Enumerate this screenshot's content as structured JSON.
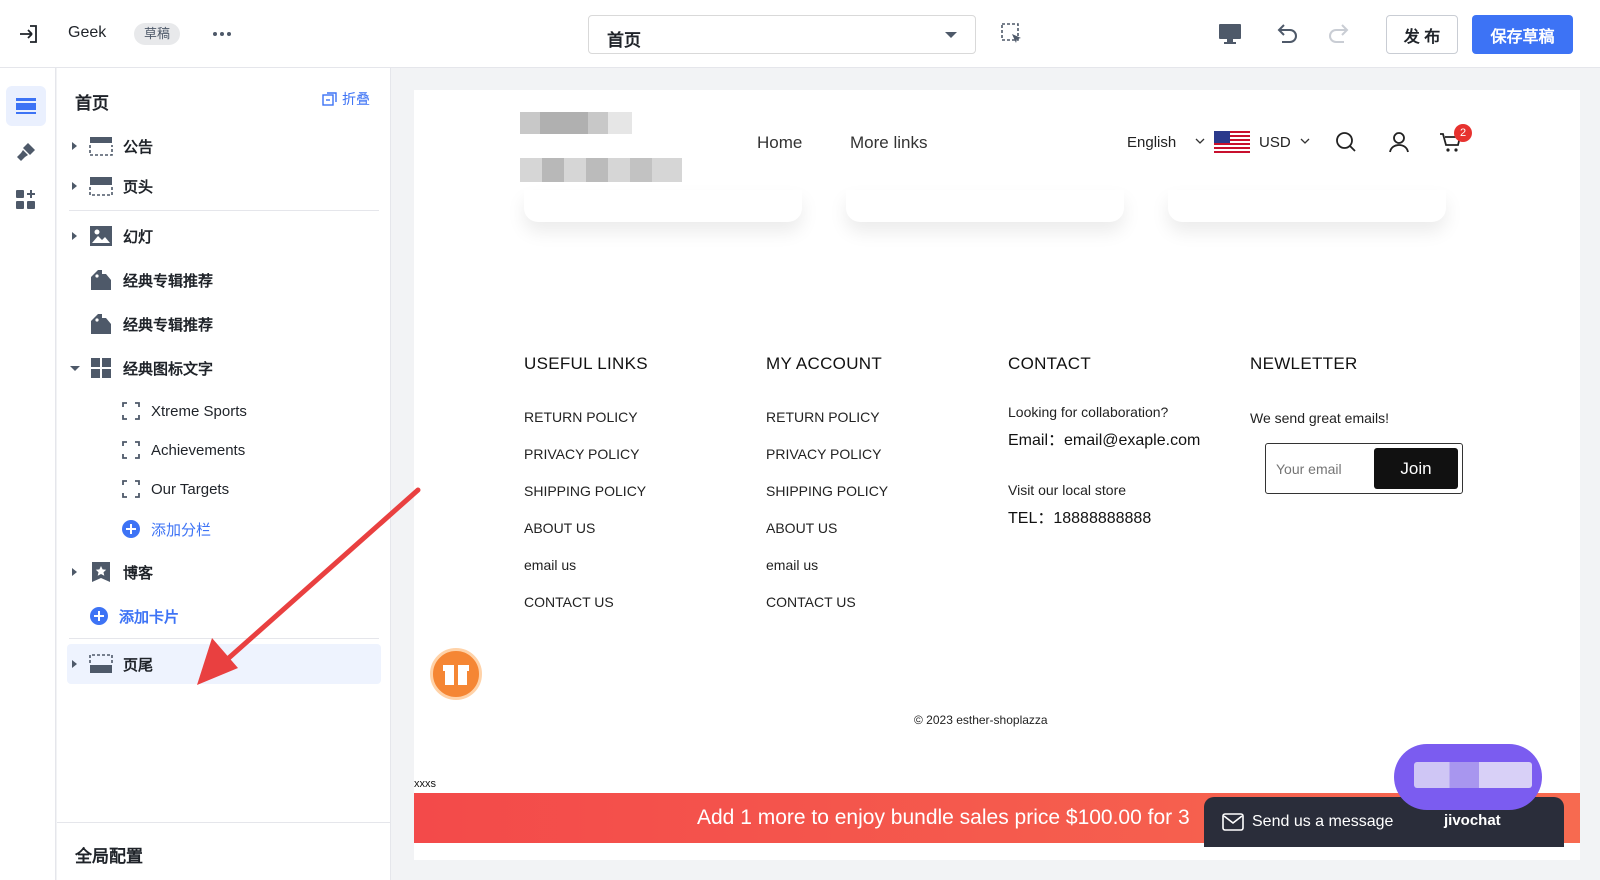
{
  "topbar": {
    "store_name": "Geek",
    "draft_badge": "草稿",
    "page_selected": "首页",
    "publish_label": "发 布",
    "save_label": "保存草稿"
  },
  "tree": {
    "title": "首页",
    "collapse_label": "折叠",
    "items": [
      {
        "label": "公告"
      },
      {
        "label": "页头"
      },
      {
        "label": "幻灯"
      },
      {
        "label": "经典专辑推荐"
      },
      {
        "label": "经典专辑推荐"
      },
      {
        "label": "经典图标文字"
      },
      {
        "label": "Xtreme Sports"
      },
      {
        "label": "Achievements"
      },
      {
        "label": "Our Targets"
      },
      {
        "label": "添加分栏"
      },
      {
        "label": "博客"
      },
      {
        "label": "添加卡片"
      },
      {
        "label": "页尾"
      }
    ],
    "global_config": "全局配置"
  },
  "preview": {
    "nav": [
      "Home",
      "More links"
    ],
    "language": "English",
    "currency": "USD",
    "cart_count": "2",
    "footer": {
      "useful_links": {
        "heading": "USEFUL LINKS",
        "links": [
          "RETURN POLICY",
          "PRIVACY POLICY",
          "SHIPPING POLICY",
          "ABOUT US",
          "email us",
          "CONTACT US"
        ]
      },
      "my_account": {
        "heading": "MY ACCOUNT",
        "links": [
          "RETURN POLICY",
          "PRIVACY POLICY",
          "SHIPPING POLICY",
          "ABOUT US",
          "email us",
          "CONTACT US"
        ]
      },
      "contact": {
        "heading": "CONTACT",
        "collab": "Looking for collaboration?",
        "email": "Email：email@exaple.com",
        "store": "Visit our local store",
        "tel": "TEL：18888888888"
      },
      "newsletter": {
        "heading": "NEWLETTER",
        "text": "We send great emails!",
        "placeholder": "Your email",
        "join_label": "Join"
      }
    },
    "copyright": "© 2023 esther-shoplazza",
    "xxxs": "xxxs",
    "banner_text": "Add 1 more to enjoy bundle sales price $100.00 for 3",
    "chat_message": "Send us a message",
    "chat_brand": "jivochat"
  },
  "colors": {
    "accent": "#3d73f5",
    "annotation_arrow": "#e94040",
    "banner": "#f34a4a",
    "chat": "#7b5cf0"
  }
}
